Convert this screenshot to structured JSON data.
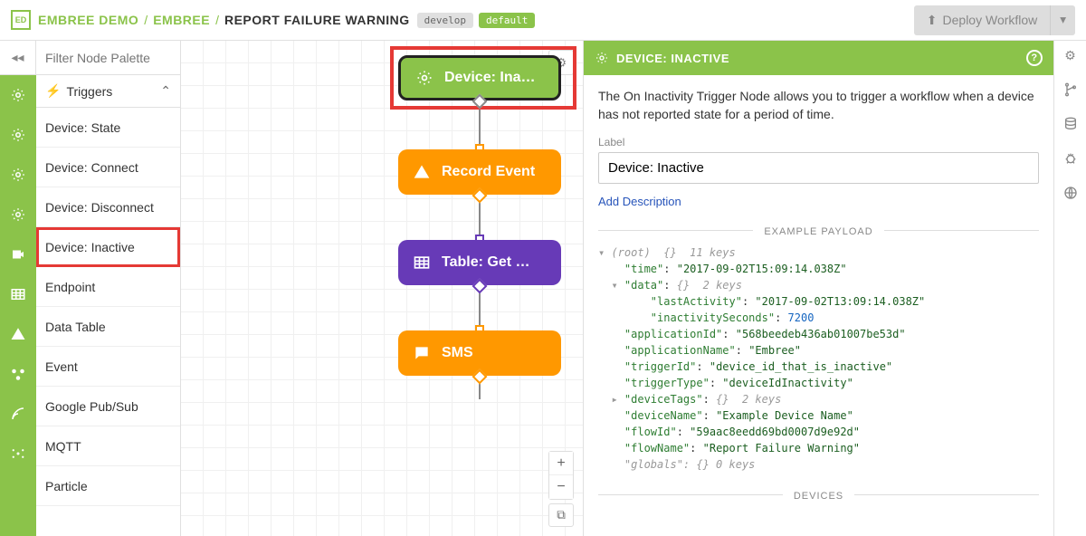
{
  "breadcrumb": {
    "org": "EMBREE DEMO",
    "app": "EMBREE",
    "workflow": "REPORT FAILURE WARNING",
    "branch": "develop",
    "default_label": "default"
  },
  "topbar": {
    "deploy_label": "Deploy Workflow"
  },
  "palette": {
    "filter_placeholder": "Filter Node Palette",
    "triggers_label": "Triggers",
    "items": [
      "Device: State",
      "Device: Connect",
      "Device: Disconnect",
      "Device: Inactive",
      "Endpoint",
      "Data Table",
      "Event",
      "Google Pub/Sub",
      "MQTT",
      "Particle"
    ],
    "highlighted_index": 3
  },
  "canvas": {
    "nodes": [
      {
        "label": "Device: Ina…",
        "type": "green"
      },
      {
        "label": "Record Event",
        "type": "orange"
      },
      {
        "label": "Table: Get …",
        "type": "purple"
      },
      {
        "label": "SMS",
        "type": "orange"
      }
    ]
  },
  "inspector": {
    "header": "DEVICE: INACTIVE",
    "description": "The On Inactivity Trigger Node allows you to trigger a workflow when a device has not reported state for a period of time.",
    "label_label": "Label",
    "label_value": "Device: Inactive",
    "add_description": "Add Description",
    "example_header": "EXAMPLE PAYLOAD",
    "devices_header": "DEVICES",
    "payload": {
      "root_comment": "(root)  {}  11 keys",
      "time": "2017-09-02T15:09:14.038Z",
      "data_comment": "{}  2 keys",
      "data": {
        "lastActivity": "2017-09-02T13:09:14.038Z",
        "inactivitySeconds": 7200
      },
      "applicationId": "568beedeb436ab01007be53d",
      "applicationName": "Embree",
      "triggerId": "device_id_that_is_inactive",
      "triggerType": "deviceIdInactivity",
      "deviceTags_comment": "{}  2 keys",
      "deviceName": "Example Device Name",
      "flowId": "59aac8eedd69bd0007d9e92d",
      "flowName": "Report Failure Warning",
      "globals_comment": "\"globals\": {} 0 keys"
    }
  }
}
